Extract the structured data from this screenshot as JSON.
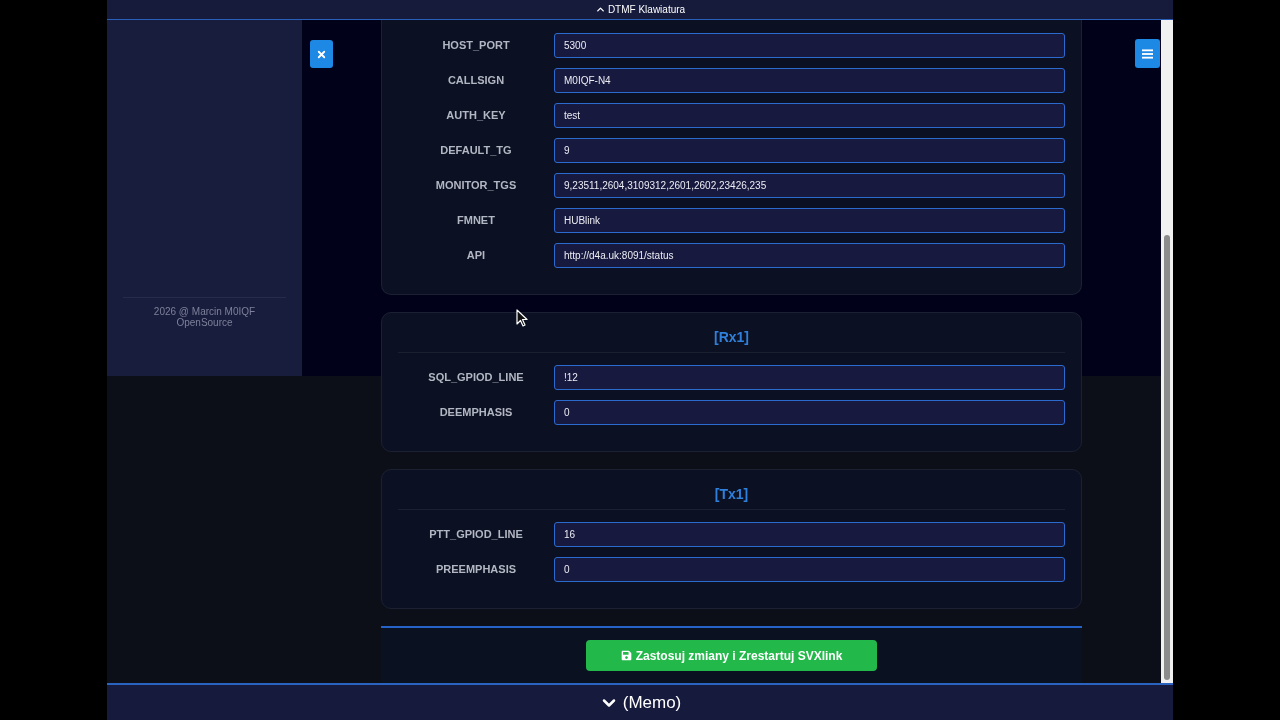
{
  "top_bar": {
    "label": "DTMF Klawiatura"
  },
  "sidebar": {
    "footer": [
      "2026 @ Marcin M0IQF",
      "OpenSource"
    ]
  },
  "sections": [
    {
      "fields": [
        {
          "label": "HOST_PORT",
          "value": "5300"
        },
        {
          "label": "CALLSIGN",
          "value": "M0IQF-N4"
        },
        {
          "label": "AUTH_KEY",
          "value": "test"
        },
        {
          "label": "DEFAULT_TG",
          "value": "9"
        },
        {
          "label": "MONITOR_TGS",
          "value": "9,23511,2604,3109312,2601,2602,23426,235"
        },
        {
          "label": "FMNET",
          "value": "HUBlink"
        },
        {
          "label": "API",
          "value": "http://d4a.uk:8091/status"
        }
      ]
    },
    {
      "title": "[Rx1]",
      "fields": [
        {
          "label": "SQL_GPIOD_LINE",
          "value": "!12"
        },
        {
          "label": "DEEMPHASIS",
          "value": "0"
        }
      ]
    },
    {
      "title": "[Tx1]",
      "fields": [
        {
          "label": "PTT_GPIOD_LINE",
          "value": "16"
        },
        {
          "label": "PREEMPHASIS",
          "value": "0"
        }
      ]
    }
  ],
  "apply_button": {
    "label": "Zastosuj zmiany i Zrestartuj SVXlink"
  },
  "bottom_bar": {
    "label": "(Memo)"
  }
}
